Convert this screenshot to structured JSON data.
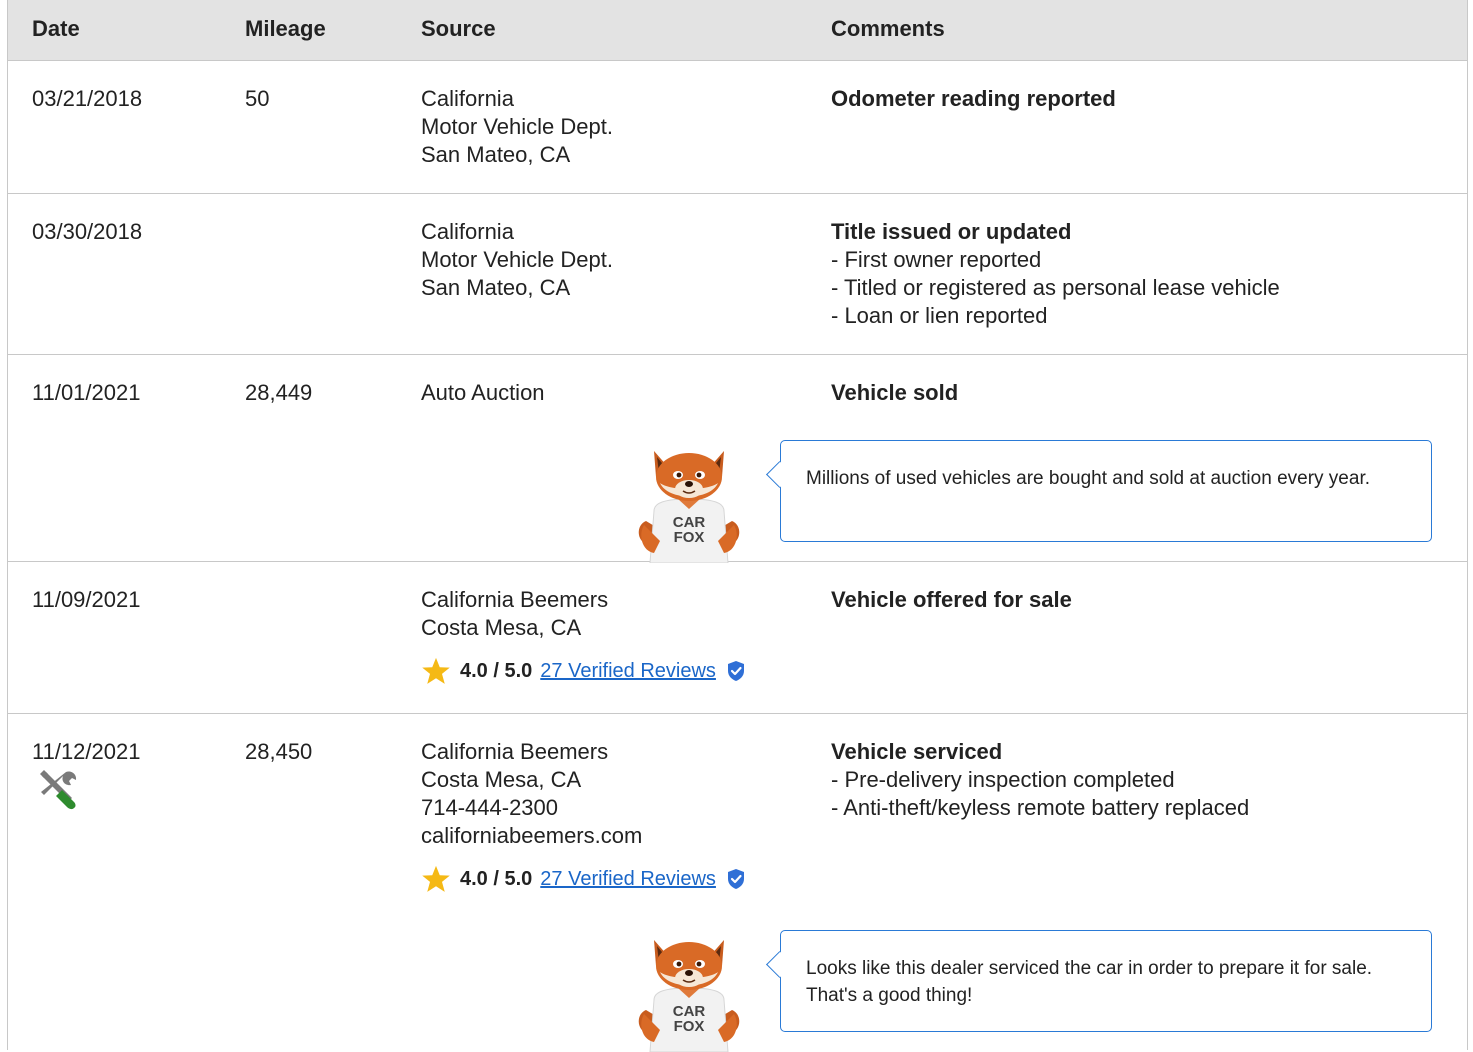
{
  "headers": {
    "date": "Date",
    "mileage": "Mileage",
    "source": "Source",
    "comments": "Comments"
  },
  "rows": [
    {
      "date": "03/21/2018",
      "mileage": "50",
      "source": [
        "California",
        "Motor Vehicle Dept.",
        "San Mateo, CA"
      ],
      "comment_title": "Odometer reading reported",
      "comment_items": []
    },
    {
      "date": "03/30/2018",
      "mileage": "",
      "source": [
        "California",
        "Motor Vehicle Dept.",
        "San Mateo, CA"
      ],
      "comment_title": "Title issued or updated",
      "comment_items": [
        "- First owner reported",
        "- Titled or registered as personal lease vehicle",
        "- Loan or lien reported"
      ]
    },
    {
      "date": "11/01/2021",
      "mileage": "28,449",
      "source": [
        "Auto Auction"
      ],
      "comment_title": "Vehicle sold",
      "comment_items": [],
      "tip": "Millions of used vehicles are bought and sold at auction every year."
    },
    {
      "date": "11/09/2021",
      "mileage": "",
      "source": [
        "California Beemers",
        "Costa Mesa, CA"
      ],
      "comment_title": "Vehicle offered for sale",
      "comment_items": [],
      "rating": {
        "score": "4.0 / 5.0",
        "reviews_link": "27 Verified Reviews"
      }
    },
    {
      "date": "11/12/2021",
      "mileage": "28,450",
      "source": [
        "California Beemers",
        "Costa Mesa, CA",
        "714-444-2300",
        "californiabeemers.com"
      ],
      "comment_title": "Vehicle serviced",
      "comment_items": [
        "- Pre-delivery inspection completed",
        "- Anti-theft/keyless remote battery replaced"
      ],
      "rating": {
        "score": "4.0 / 5.0",
        "reviews_link": "27 Verified Reviews"
      },
      "tip": "Looks like this dealer serviced the car in order to prepare it for sale. That's a good thing!",
      "icon": "service-wrench-icon"
    }
  ],
  "fox_shirt": [
    "CAR",
    "FOX"
  ],
  "colors": {
    "header_bg": "#e3e3e3",
    "border": "#c8c8c8",
    "link": "#1a66c8",
    "bubble_border": "#2a7ad6",
    "star": "#f5b915",
    "verified_badge": "#2f6fd6",
    "wrench_green": "#2e8b2e"
  }
}
